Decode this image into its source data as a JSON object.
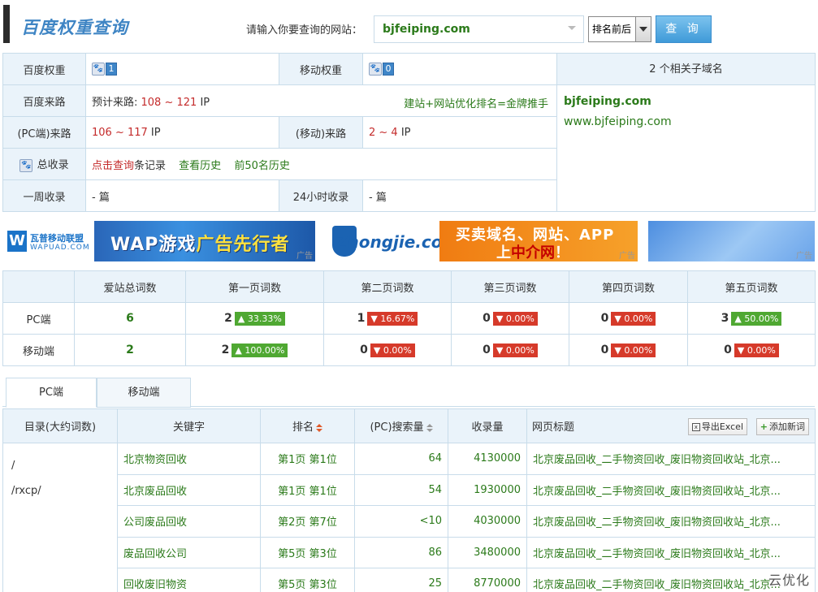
{
  "header": {
    "logo": "百度权重查询",
    "query_label": "请输入你要查询的网站：",
    "site_value": "bjfeiping.com",
    "rank_select": "排名前后",
    "query_button": "查 询"
  },
  "info": {
    "baidu_weight_label": "百度权重",
    "baidu_weight_value": "1",
    "mobile_weight_label": "移动权重",
    "mobile_weight_value": "0",
    "baidu_source_label": "百度来路",
    "baidu_source_prefix": "预计来路: ",
    "baidu_source_range": "108 ~ 121",
    "baidu_source_unit": " IP",
    "promo_link": "建站+网站优化排名=金牌推手",
    "pc_source_label": "(PC端)来路",
    "pc_source_range": "106 ~ 117",
    "pc_source_unit": " IP",
    "mobile_source_label": "(移动)来路",
    "mobile_source_range": "2 ~ 4",
    "mobile_source_unit": " IP",
    "index_label": "总收录",
    "index_link": "点击查询",
    "index_suffix": "条记录",
    "history_link": "查看历史",
    "top50_link": "前50名历史",
    "week_label": "一周收录",
    "week_value": "- 篇",
    "day_label": "24小时收录",
    "day_value": "- 篇",
    "subdomain_head": "2 个相关子域名",
    "subdomains": [
      "bjfeiping.com",
      "www.bjfeiping.com"
    ]
  },
  "banners": {
    "b1_mark": "W",
    "b1_name": "瓦普移动联盟",
    "b1_domain": "WAPUAD.COM",
    "b1_slogan_a": "WAP游戏",
    "b1_slogan_b": "广告先行者",
    "b2_word": "Zhongjie.com",
    "b2_line1": "买卖域名、网站、APP",
    "b2_line2_a": "上",
    "b2_line2_b": "中介网",
    "b2_line2_c": "！",
    "ad_tag": "广告"
  },
  "stats": {
    "headers": [
      "",
      "爱站总词数",
      "第一页词数",
      "第二页词数",
      "第三页词数",
      "第四页词数",
      "第五页词数"
    ],
    "rows": [
      {
        "label": "PC端",
        "total": "6",
        "p1": "2",
        "p1pct": "▲ 33.33%",
        "p2": "1",
        "p2pct": "▼ 16.67%",
        "p3": "0",
        "p3pct": "▼ 0.00%",
        "p4": "0",
        "p4pct": "▼ 0.00%",
        "p5": "3",
        "p5pct": "▲ 50.00%"
      },
      {
        "label": "移动端",
        "total": "2",
        "p1": "2",
        "p1pct": "▲ 100.00%",
        "p2": "0",
        "p2pct": "▼ 0.00%",
        "p3": "0",
        "p3pct": "▼ 0.00%",
        "p4": "0",
        "p4pct": "▼ 0.00%",
        "p5": "0",
        "p5pct": "▼ 0.00%"
      }
    ]
  },
  "tabs": [
    "PC端",
    "移动端"
  ],
  "keywords": {
    "headers": {
      "dir": "目录(大约词数)",
      "keyword": "关键字",
      "rank": "排名",
      "volume": "(PC)搜索量",
      "records": "收录量",
      "title": "网页标题",
      "export": "导出Excel",
      "add": "添加新词"
    },
    "dirs": [
      "/",
      "/rxcp/"
    ],
    "rows": [
      {
        "keyword": "北京物资回收",
        "rank": "第1页 第1位",
        "volume": "64",
        "records": "4130000",
        "title": "北京废品回收_二手物资回收_废旧物资回收站_北京..."
      },
      {
        "keyword": "北京废品回收",
        "rank": "第1页 第1位",
        "volume": "54",
        "records": "1930000",
        "title": "北京废品回收_二手物资回收_废旧物资回收站_北京..."
      },
      {
        "keyword": "公司废品回收",
        "rank": "第2页 第7位",
        "volume": "<10",
        "records": "4030000",
        "title": "北京废品回收_二手物资回收_废旧物资回收站_北京..."
      },
      {
        "keyword": "废品回收公司",
        "rank": "第5页 第3位",
        "volume": "86",
        "records": "3480000",
        "title": "北京废品回收_二手物资回收_废旧物资回收站_北京..."
      },
      {
        "keyword": "回收废旧物资",
        "rank": "第5页 第3位",
        "volume": "25",
        "records": "8770000",
        "title": "北京废品回收_二手物资回收_废旧物资回收站_北京..."
      }
    ]
  },
  "watermark": "云优化"
}
